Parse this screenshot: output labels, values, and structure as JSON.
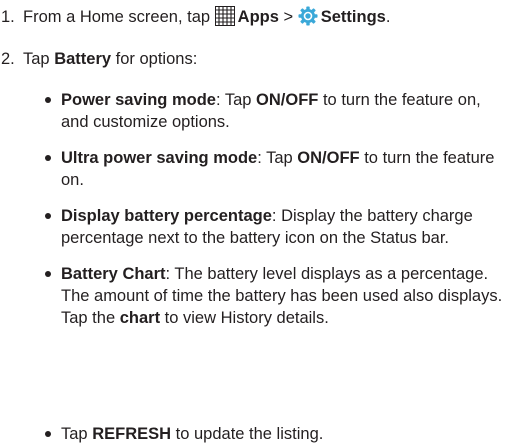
{
  "steps": [
    {
      "number": "1.",
      "prefix": "From a Home screen, tap",
      "apps_label": "Apps",
      "sep": ">",
      "settings_label": "Settings",
      "end": "."
    },
    {
      "number": "2.",
      "prefix": "Tap",
      "bold": "Battery",
      "suffix": "for options:"
    }
  ],
  "bullets": [
    {
      "term": "Power saving mode",
      "text_pre": ": Tap",
      "bold": "ON/OFF",
      "text_post": "to turn the feature on, and customize options."
    },
    {
      "term": "Ultra power saving mode",
      "text_pre": ": Tap",
      "bold": "ON/OFF",
      "text_post": "to turn the feature on."
    },
    {
      "term": "Display battery percentage",
      "text": ": Display the battery charge percentage next to the battery icon on the Status bar."
    },
    {
      "term": "Battery Chart",
      "text_pre": ": The battery level displays as a percentage. The amount of time the battery has been used also displays. Tap the",
      "bold": "chart",
      "text_post": "to view History details."
    },
    {
      "prefix": "Tap",
      "bold": "REFRESH",
      "suffix": "to update the listing."
    }
  ],
  "icons": {
    "apps": "apps-grid-icon",
    "settings": "settings-gear-icon"
  },
  "colors": {
    "text": "#231f20",
    "settings_icon": "#3aa8d8"
  }
}
